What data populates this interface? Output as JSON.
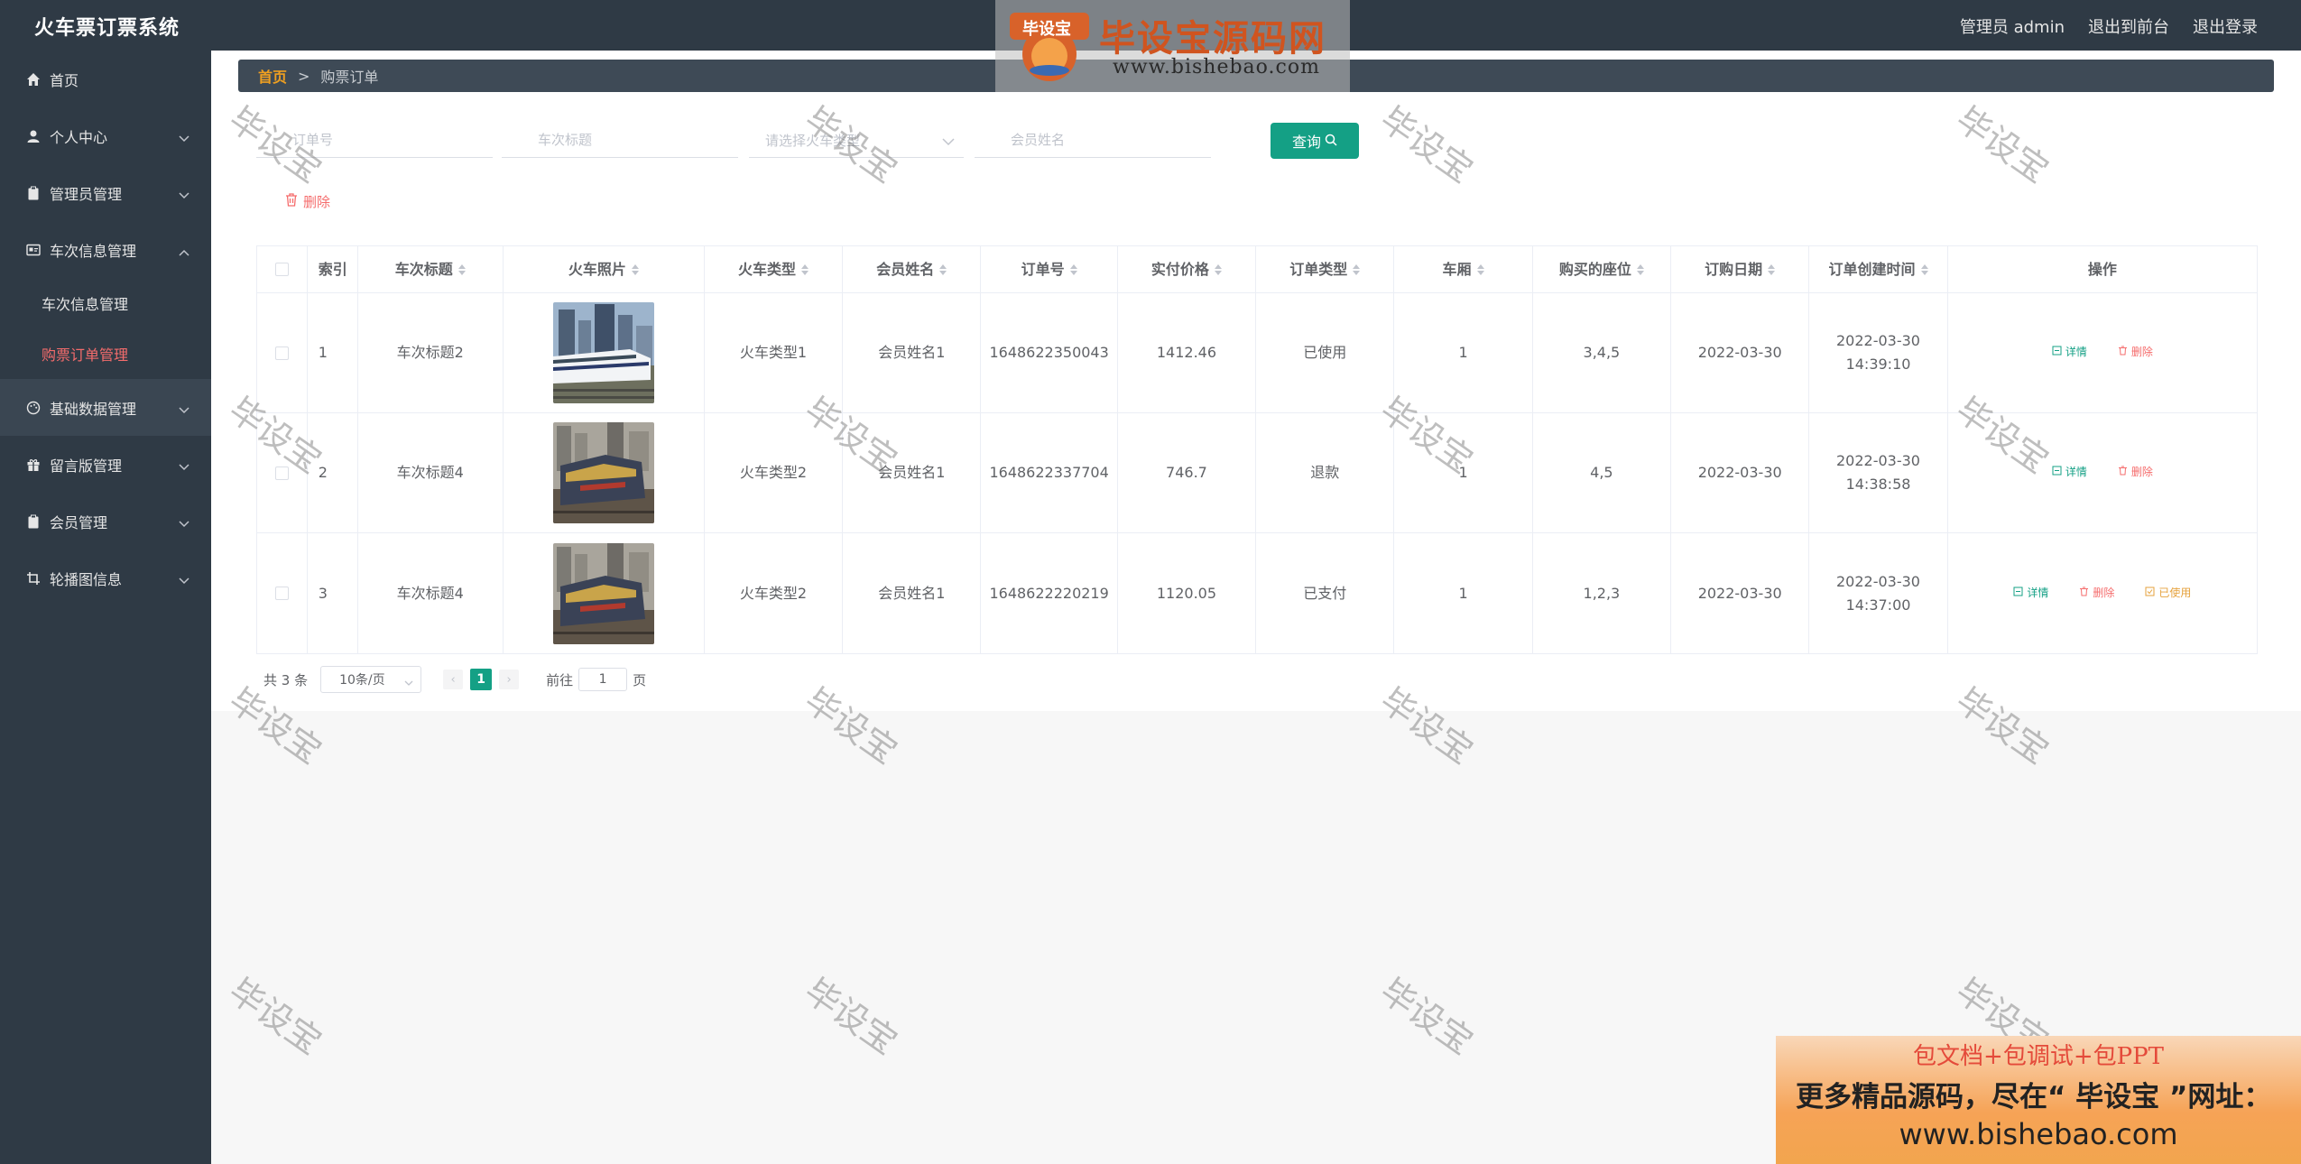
{
  "header": {
    "app_title": "火车票订票系统",
    "admin_label": "管理员 admin",
    "front_link": "退出到前台",
    "logout_link": "退出登录"
  },
  "sidebar": {
    "items": [
      {
        "label": "首页",
        "icon": "home-icon"
      },
      {
        "label": "个人中心",
        "icon": "user-icon"
      },
      {
        "label": "管理员管理",
        "icon": "clipboard-icon"
      },
      {
        "label": "车次信息管理",
        "icon": "card-icon"
      },
      {
        "label": "基础数据管理",
        "icon": "palette-icon"
      },
      {
        "label": "留言版管理",
        "icon": "gift-icon"
      },
      {
        "label": "会员管理",
        "icon": "clipboard-icon"
      },
      {
        "label": "轮播图信息",
        "icon": "crop-icon"
      }
    ],
    "submenu": [
      {
        "label": "车次信息管理"
      },
      {
        "label": "购票订单管理"
      }
    ]
  },
  "breadcrumb": {
    "home": "首页",
    "separator": ">",
    "current": "购票订单"
  },
  "search": {
    "order_no_placeholder": "订单号",
    "train_title_placeholder": "车次标题",
    "train_type_placeholder": "请选择火车类型",
    "member_name_placeholder": "会员姓名",
    "query_label": "查询"
  },
  "toolbar": {
    "delete_label": "删除"
  },
  "table": {
    "headers": [
      "索引",
      "车次标题",
      "火车照片",
      "火车类型",
      "会员姓名",
      "订单号",
      "实付价格",
      "订单类型",
      "车厢",
      "购买的座位",
      "订购日期",
      "订单创建时间",
      "操作"
    ],
    "rows": [
      {
        "index": "1",
        "title": "车次标题2",
        "type": "火车类型1",
        "member": "会员姓名1",
        "order_no": "1648622350043",
        "price": "1412.46",
        "order_type": "已使用",
        "car": "1",
        "seats": "3,4,5",
        "date": "2022-03-30",
        "created": "2022-03-30 14:39:10"
      },
      {
        "index": "2",
        "title": "车次标题4",
        "type": "火车类型2",
        "member": "会员姓名1",
        "order_no": "1648622337704",
        "price": "746.7",
        "order_type": "退款",
        "car": "1",
        "seats": "4,5",
        "date": "2022-03-30",
        "created": "2022-03-30 14:38:58"
      },
      {
        "index": "3",
        "title": "车次标题4",
        "type": "火车类型2",
        "member": "会员姓名1",
        "order_no": "1648622220219",
        "price": "1120.05",
        "order_type": "已支付",
        "car": "1",
        "seats": "1,2,3",
        "date": "2022-03-30",
        "created": "2022-03-30 14:37:00"
      }
    ],
    "ops": {
      "detail": "详情",
      "delete": "删除",
      "use": "已使用"
    }
  },
  "pager": {
    "total": "共 3 条",
    "page_size": "10条/页",
    "current_page": "1",
    "goto_label": "前往",
    "goto_value": "1",
    "page_unit": "页",
    "prev": "‹",
    "next": "›"
  },
  "watermark": {
    "logo_badge": "毕设宝",
    "logo_title": "毕设宝源码网",
    "logo_url": "www.bishebao.com",
    "text": "毕设宝"
  },
  "promo": {
    "line1": "包文档+包调试+包PPT",
    "line2": "更多精品源码，尽在“ 毕设宝 ”网址：",
    "line3": "www.bishebao.com"
  },
  "colors": {
    "sidebar_bg": "#2f3a45",
    "accent": "#14a085",
    "danger": "#f56c6c",
    "warning": "#e6a23c",
    "breadcrumb_home": "#f0a020"
  }
}
